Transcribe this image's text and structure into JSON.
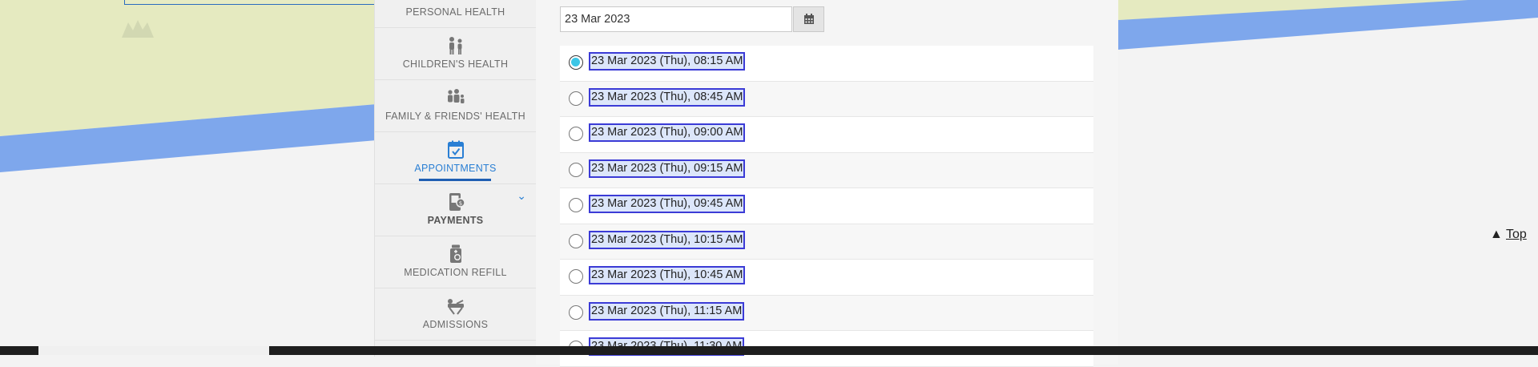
{
  "sidebar": {
    "items": [
      {
        "label": "PERSONAL HEALTH",
        "icon": "person-icon"
      },
      {
        "label": "CHILDREN'S HEALTH",
        "icon": "children-icon"
      },
      {
        "label": "FAMILY & FRIENDS' HEALTH",
        "icon": "family-icon"
      },
      {
        "label": "APPOINTMENTS",
        "icon": "calendar-check-icon",
        "active": true
      },
      {
        "label": "PAYMENTS",
        "icon": "payment-icon"
      },
      {
        "label": "MEDICATION REFILL",
        "icon": "medicine-bottle-icon"
      },
      {
        "label": "ADMISSIONS",
        "icon": "hospital-bed-icon"
      }
    ]
  },
  "appointment": {
    "date_value": "23 Mar 2023",
    "calendar_icon": "calendar-icon",
    "slots": [
      {
        "label": "23 Mar 2023 (Thu), 08:15 AM",
        "selected": true
      },
      {
        "label": "23 Mar 2023 (Thu), 08:45 AM",
        "selected": false
      },
      {
        "label": "23 Mar 2023 (Thu), 09:00 AM",
        "selected": false
      },
      {
        "label": "23 Mar 2023 (Thu), 09:15 AM",
        "selected": false
      },
      {
        "label": "23 Mar 2023 (Thu), 09:45 AM",
        "selected": false
      },
      {
        "label": "23 Mar 2023 (Thu), 10:15 AM",
        "selected": false
      },
      {
        "label": "23 Mar 2023 (Thu), 10:45 AM",
        "selected": false
      },
      {
        "label": "23 Mar 2023 (Thu), 11:15 AM",
        "selected": false
      },
      {
        "label": "23 Mar 2023 (Thu), 11:30 AM",
        "selected": false
      }
    ]
  },
  "top_link": {
    "label": "Top"
  },
  "colors": {
    "accent": "#2a7fd4",
    "radio_selected": "#3cc6e6",
    "map_land": "#e5eac0",
    "map_river": "#7ea7ec"
  }
}
